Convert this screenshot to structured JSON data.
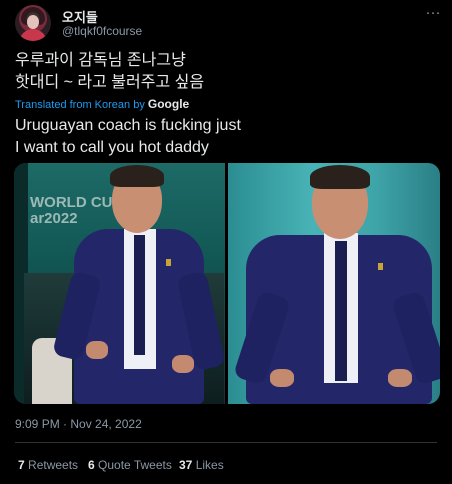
{
  "author": {
    "display_name": "오지들",
    "handle": "@tlqkf0fcourse"
  },
  "tweet": {
    "original_lines": [
      "우루과이 감독님 존나그냥",
      "핫대디 ~ 라고 불러주고 싶음"
    ],
    "translated_label": "Translated from Korean by",
    "translator_brand": "Google",
    "translation_lines": [
      "Uruguayan coach is fucking just",
      "I want to call you hot daddy"
    ],
    "timestamp": "9:09 PM · Nov 24, 2022"
  },
  "media": {
    "left_banner_lines": [
      "WORLD CU",
      "ar2022"
    ]
  },
  "stats": {
    "retweets": {
      "count": "7",
      "label": "Retweets"
    },
    "quotes": {
      "count": "6",
      "label": "Quote Tweets"
    },
    "likes": {
      "count": "37",
      "label": "Likes"
    }
  },
  "colors": {
    "background": "#000000",
    "text_primary": "#e7e9ea",
    "text_secondary": "#8b98a5",
    "link": "#1d9bf0",
    "divider": "#2f3336"
  },
  "icons": {
    "more": "more-horizontal-icon"
  }
}
